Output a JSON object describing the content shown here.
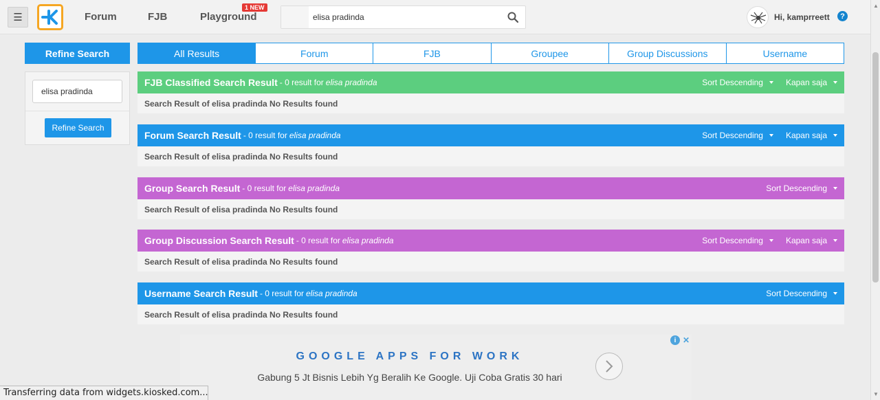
{
  "header": {
    "nav": [
      "Forum",
      "FJB",
      "Playground"
    ],
    "new_badge": "1 NEW",
    "search_value": "elisa pradinda",
    "greeting": "Hi, kamprreett",
    "help": "?"
  },
  "sidebar": {
    "title": "Refine Search",
    "input_value": "elisa pradinda",
    "button_label": "Refine Search"
  },
  "tabs": [
    {
      "label": "All Results",
      "active": true
    },
    {
      "label": "Forum",
      "active": false
    },
    {
      "label": "FJB",
      "active": false
    },
    {
      "label": "Groupee",
      "active": false
    },
    {
      "label": "Group Discussions",
      "active": false
    },
    {
      "label": "Username",
      "active": false
    }
  ],
  "sections": [
    {
      "title": "FJB Classified Search Result",
      "count": "- 0 result for",
      "query": "elisa pradinda",
      "sort": "Sort Descending",
      "time": "Kapan saja",
      "body": "Search Result of elisa pradinda No Results found",
      "color": "#5cce7f"
    },
    {
      "title": "Forum Search Result",
      "count": "- 0 result for",
      "query": "elisa pradinda",
      "sort": "Sort Descending",
      "time": "Kapan saja",
      "body": "Search Result of elisa pradinda No Results found",
      "color": "#1e96e8"
    },
    {
      "title": "Group Search Result",
      "count": "- 0 result for",
      "query": "elisa pradinda",
      "sort": "Sort Descending",
      "body": "Search Result of elisa pradinda No Results found",
      "color": "#c466d2"
    },
    {
      "title": "Group Discussion Search Result",
      "count": "- 0 result for",
      "query": "elisa pradinda",
      "sort": "Sort Descending",
      "time": "Kapan saja",
      "body": "Search Result of elisa pradinda No Results found",
      "color": "#c466d2"
    },
    {
      "title": "Username Search Result",
      "count": "- 0 result for",
      "query": "elisa pradinda",
      "sort": "Sort Descending",
      "body": "Search Result of elisa pradinda No Results found",
      "color": "#1e96e8"
    }
  ],
  "ad": {
    "title": "GOOGLE APPS FOR WORK",
    "text": "Gabung 5 Jt Bisnis Lebih Yg Beralih Ke Google. Uji Coba Gratis 30 hari"
  },
  "status_bar": "Transferring data from widgets.kiosked.com..."
}
